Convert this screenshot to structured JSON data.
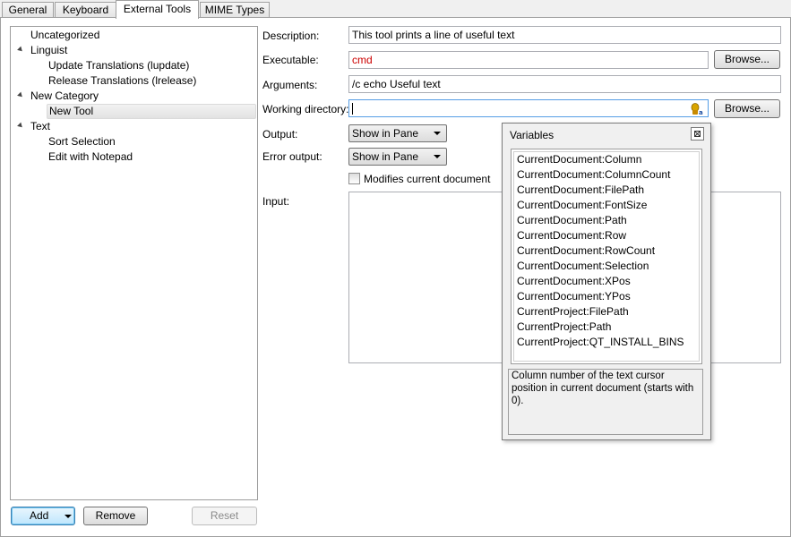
{
  "tabs": [
    {
      "label": "General"
    },
    {
      "label": "Keyboard"
    },
    {
      "label": "External Tools"
    },
    {
      "label": "MIME Types"
    }
  ],
  "active_tab": "External Tools",
  "tree": {
    "items": [
      {
        "label": "Uncategorized",
        "level": 0,
        "expanded": false
      },
      {
        "label": "Linguist",
        "level": 0,
        "expanded": true
      },
      {
        "label": "Update Translations (lupdate)",
        "level": 1
      },
      {
        "label": "Release Translations (lrelease)",
        "level": 1
      },
      {
        "label": "New Category",
        "level": 0,
        "expanded": true
      },
      {
        "label": "New Tool",
        "level": 1,
        "selected": true
      },
      {
        "label": "Text",
        "level": 0,
        "expanded": true
      },
      {
        "label": "Sort Selection",
        "level": 1
      },
      {
        "label": "Edit with Notepad",
        "level": 1
      }
    ]
  },
  "buttons": {
    "add": "Add",
    "remove": "Remove",
    "reset": "Reset",
    "browse_executable": "Browse...",
    "browse_working_dir": "Browse..."
  },
  "form": {
    "description_label": "Description:",
    "description_value": "This tool prints a line of useful text",
    "executable_label": "Executable:",
    "executable_value": "cmd",
    "arguments_label": "Arguments:",
    "arguments_value": "/c echo Useful text",
    "working_dir_label": "Working directory:",
    "working_dir_value": "",
    "output_label": "Output:",
    "output_value": "Show in Pane",
    "error_output_label": "Error output:",
    "error_output_value": "Show in Pane",
    "modifies_label": "Modifies current document",
    "modifies_checked": false,
    "input_label": "Input:",
    "input_value": ""
  },
  "variables_popup": {
    "title": "Variables",
    "items": [
      "CurrentDocument:Column",
      "CurrentDocument:ColumnCount",
      "CurrentDocument:FilePath",
      "CurrentDocument:FontSize",
      "CurrentDocument:Path",
      "CurrentDocument:Row",
      "CurrentDocument:RowCount",
      "CurrentDocument:Selection",
      "CurrentDocument:XPos",
      "CurrentDocument:YPos",
      "CurrentProject:FilePath",
      "CurrentProject:Path",
      "CurrentProject:QT_INSTALL_BINS"
    ],
    "description": "Column number of the text cursor position in current document (starts with 0)."
  },
  "colors": {
    "executable_text": "#cc0000",
    "selection_bg": "#e6e6e6",
    "border": "#a0a0a0"
  }
}
